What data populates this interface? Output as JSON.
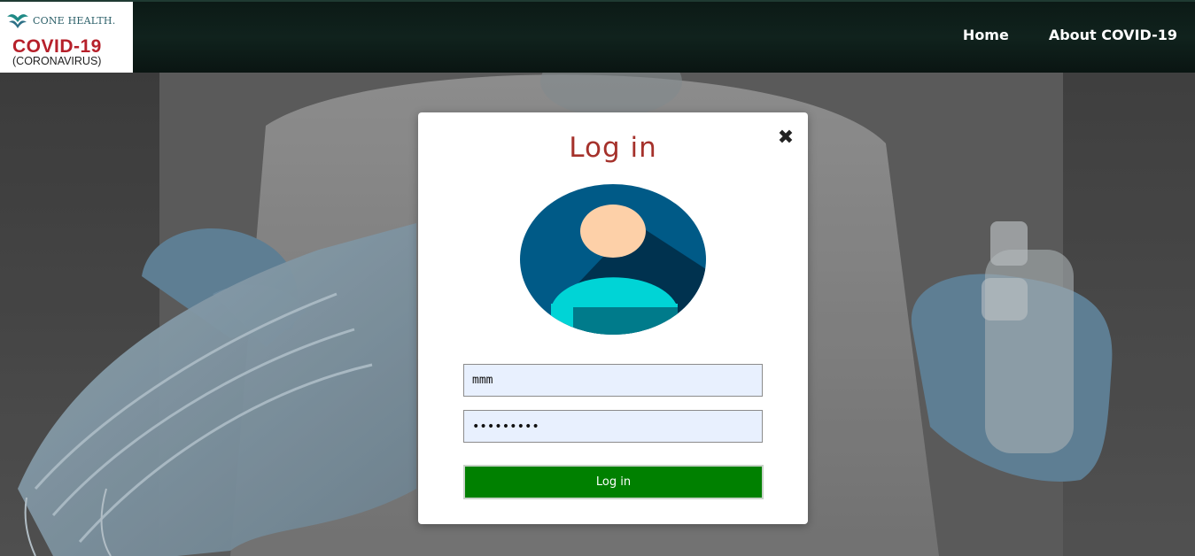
{
  "header": {
    "logo": {
      "brand": "CONE HEALTH.",
      "title": "COVID-19",
      "subtitle": "(CORONAVIRUS)"
    },
    "nav": [
      {
        "label": "Home"
      },
      {
        "label": "About COVID-19"
      }
    ]
  },
  "modal": {
    "title": "Log in",
    "close_symbol": "✖",
    "username_value": "mmm",
    "password_value": "•••••••••",
    "submit_label": "Log in"
  },
  "icons": {
    "avatar": "user-avatar-icon",
    "close": "close-icon",
    "brand": "cone-health-logo-icon"
  },
  "colors": {
    "title": "#a5312b",
    "submit": "#008000",
    "input_bg": "#e8f0fe",
    "avatar_circle": "#005a87",
    "avatar_head": "#fdd0a8",
    "avatar_body": "#00d4d6"
  }
}
